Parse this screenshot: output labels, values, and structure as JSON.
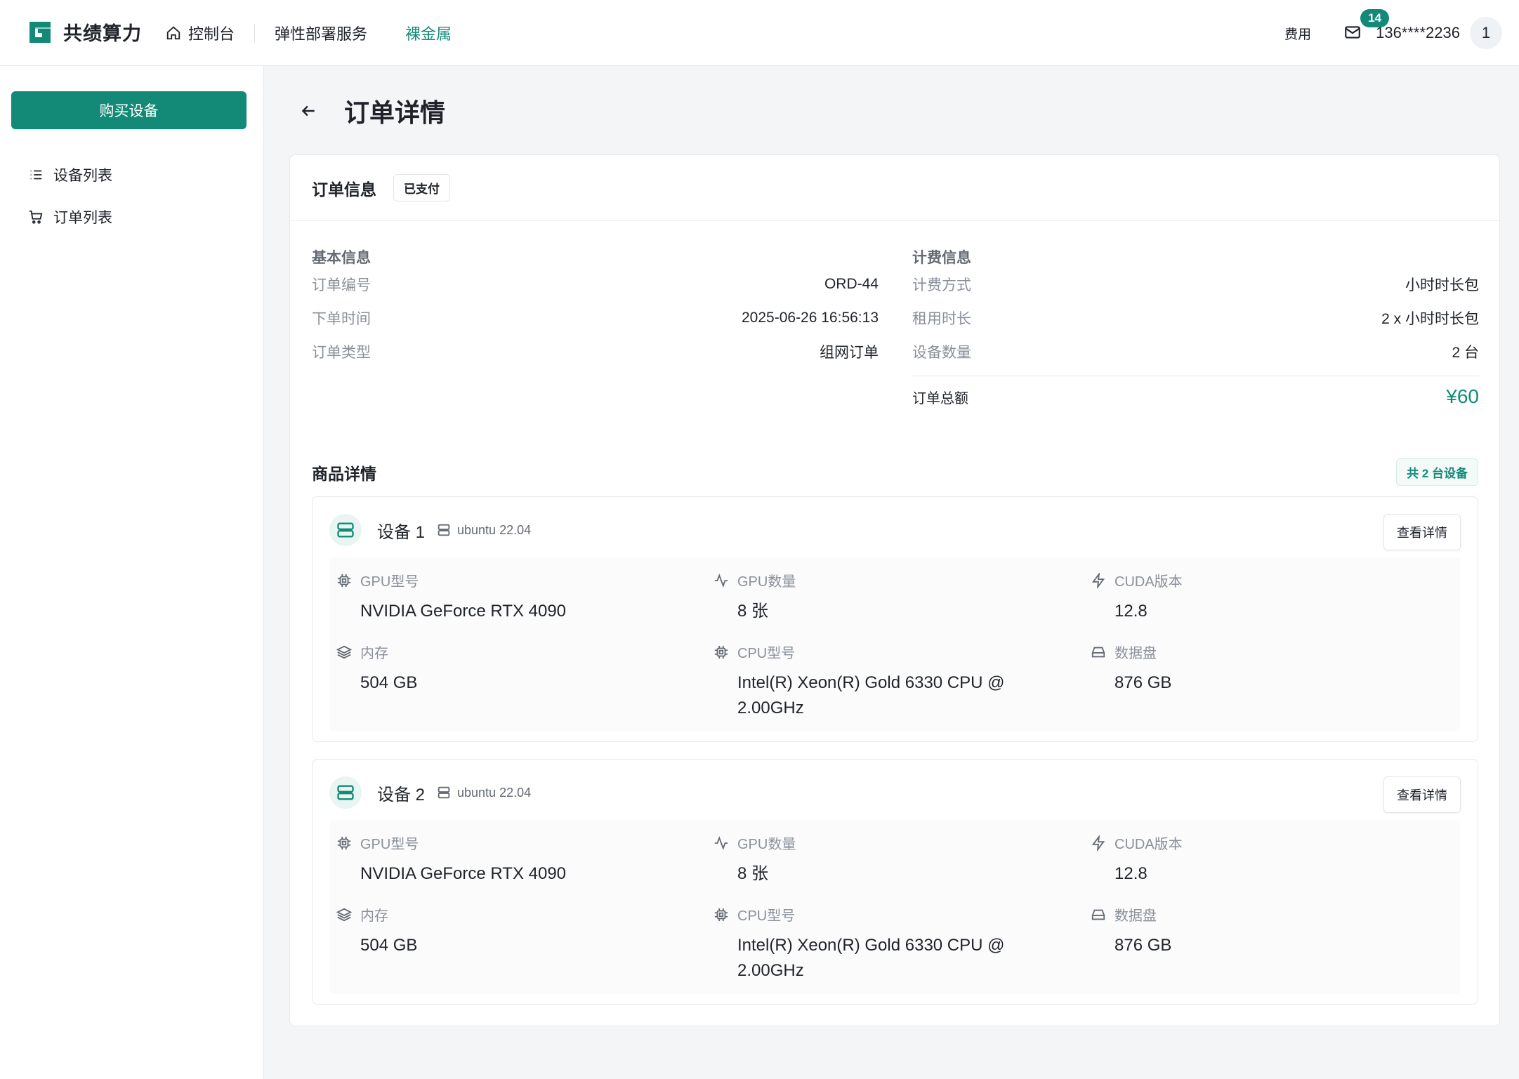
{
  "header": {
    "brand": "共绩算力",
    "nav": {
      "console": "控制台",
      "elastic": "弹性部署服务",
      "baremetal": "裸金属"
    },
    "fee": "费用",
    "mail_count": "14",
    "user": "136****2236",
    "avatar": "1"
  },
  "sidebar": {
    "buy": "购买设备",
    "items": [
      {
        "label": "设备列表",
        "icon": "list-icon"
      },
      {
        "label": "订单列表",
        "icon": "cart-icon"
      }
    ]
  },
  "page": {
    "title": "订单详情"
  },
  "order": {
    "card_title": "订单信息",
    "status": "已支付",
    "basic_label": "基本信息",
    "basic": [
      {
        "k": "订单编号",
        "v": "ORD-44"
      },
      {
        "k": "下单时间",
        "v": "2025-06-26 16:56:13"
      },
      {
        "k": "订单类型",
        "v": "组网订单"
      }
    ],
    "billing_label": "计费信息",
    "billing": [
      {
        "k": "计费方式",
        "v": "小时时长包"
      },
      {
        "k": "租用时长",
        "v": "2 x 小时时长包"
      },
      {
        "k": "设备数量",
        "v": "2 台"
      }
    ],
    "total_label": "订单总额",
    "total": "¥60"
  },
  "goods": {
    "title": "商品详情",
    "count": "共 2 台设备",
    "detail_btn": "查看详情",
    "devices": [
      {
        "name": "设备 1",
        "os": "ubuntu 22.04",
        "gpu_model_label": "GPU型号",
        "gpu_model": "NVIDIA GeForce RTX 4090",
        "gpu_count_label": "GPU数量",
        "gpu_count": "8 张",
        "cuda_label": "CUDA版本",
        "cuda": "12.8",
        "mem_label": "内存",
        "mem": "504 GB",
        "cpu_label": "CPU型号",
        "cpu": "Intel(R) Xeon(R) Gold 6330 CPU @ 2.00GHz",
        "disk_label": "数据盘",
        "disk": "876 GB"
      },
      {
        "name": "设备 2",
        "os": "ubuntu 22.04",
        "gpu_model_label": "GPU型号",
        "gpu_model": "NVIDIA GeForce RTX 4090",
        "gpu_count_label": "GPU数量",
        "gpu_count": "8 张",
        "cuda_label": "CUDA版本",
        "cuda": "12.8",
        "mem_label": "内存",
        "mem": "504 GB",
        "cpu_label": "CPU型号",
        "cpu": "Intel(R) Xeon(R) Gold 6330 CPU @ 2.00GHz",
        "disk_label": "数据盘",
        "disk": "876 GB"
      }
    ]
  },
  "colors": {
    "accent": "#138a78"
  }
}
